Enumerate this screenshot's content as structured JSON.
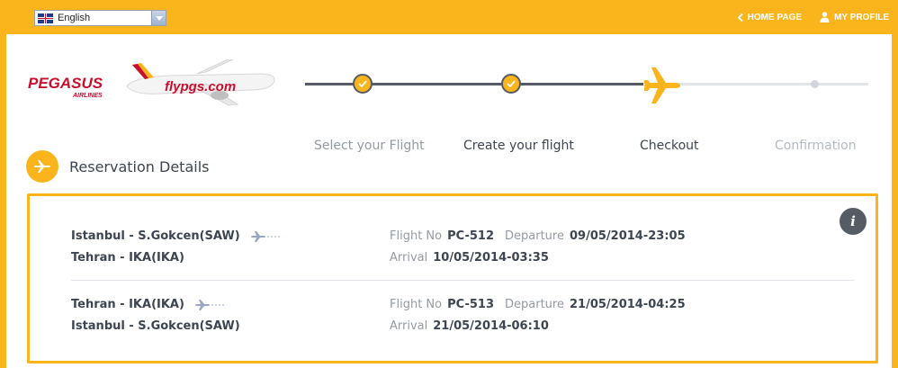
{
  "top_bar": {
    "language": "English",
    "links": [
      {
        "label": "HOME PAGE",
        "icon": "chevron-left-icon"
      },
      {
        "label": "MY PROFILE",
        "icon": "user-icon"
      }
    ]
  },
  "logo": {
    "brand": "PEGASUS",
    "subbrand": "AIRLINES",
    "livery": "flypgs.com"
  },
  "steps": [
    {
      "label": "Select your Flight",
      "state": "done"
    },
    {
      "label": "Create your flight",
      "state": "done"
    },
    {
      "label": "Checkout",
      "state": "current"
    },
    {
      "label": "Confirmation",
      "state": "pending"
    }
  ],
  "reservation": {
    "title": "Reservation Details",
    "labels": {
      "flight_no": "Flight No",
      "departure": "Departure",
      "arrival": "Arrival"
    },
    "flights": [
      {
        "from": "Istanbul - S.Gokcen(SAW)",
        "to": "Tehran - IKA(IKA)",
        "flight_no": "PC-512",
        "departure": "09/05/2014-23:05",
        "arrival": "10/05/2014-03:35"
      },
      {
        "from": "Tehran - IKA(IKA)",
        "to": "Istanbul - S.Gokcen(SAW)",
        "flight_no": "PC-513",
        "departure": "21/05/2014-04:25",
        "arrival": "21/05/2014-06:10"
      }
    ]
  },
  "colors": {
    "brand_yellow": "#fbb51c",
    "dark_slate": "#3d4551",
    "muted_text": "#939aa3",
    "pending_text": "#b3b9c1"
  }
}
